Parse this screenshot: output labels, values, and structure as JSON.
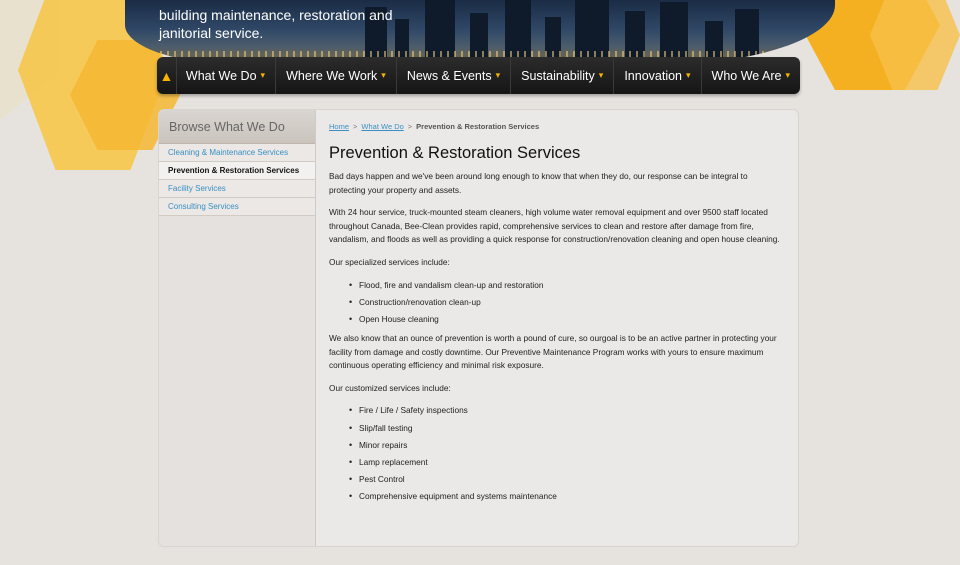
{
  "hero": {
    "tagline": "building maintenance, restoration and janitorial service."
  },
  "nav": {
    "home_icon": "home-icon",
    "items": [
      {
        "label": "What We Do"
      },
      {
        "label": "Where We Work"
      },
      {
        "label": "News & Events"
      },
      {
        "label": "Sustainability"
      },
      {
        "label": "Innovation"
      },
      {
        "label": "Who We Are"
      }
    ]
  },
  "sidebar": {
    "title": "Browse What We Do",
    "items": [
      {
        "label": "Cleaning & Maintenance Services",
        "active": false
      },
      {
        "label": "Prevention & Restoration Services",
        "active": true
      },
      {
        "label": "Facility Services",
        "active": false
      },
      {
        "label": "Consulting Services",
        "active": false
      }
    ]
  },
  "breadcrumb": {
    "home": "Home",
    "parent": "What We Do",
    "separator": ">",
    "current": "Prevention & Restoration Services"
  },
  "main": {
    "title": "Prevention & Restoration Services",
    "intro": "Bad days happen and we've been around long enough to know that when they do, our response can be integral to protecting your property and assets.",
    "para2": "With 24 hour service, truck-mounted steam cleaners, high volume water removal equipment and over 9500 staff located throughout Canada, Bee-Clean provides rapid, comprehensive services to clean and restore after damage from fire, vandalism, and floods as well as providing a quick response for construction/renovation cleaning and open house cleaning.",
    "specialized_heading": "Our specialized services include:",
    "specialized": [
      "Flood, fire and vandalism clean-up and restoration",
      "Construction/renovation clean-up",
      "Open House cleaning"
    ],
    "para3": "We also know that an ounce of prevention is worth a pound of cure, so ourgoal is to be an active partner in protecting your facility from damage and costly downtime. Our Preventive Maintenance Program works with yours to ensure maximum continuous operating efficiency and minimal risk exposure.",
    "customized_heading": "Our customized services include:",
    "customized": [
      "Fire / Life / Safety inspections",
      "Slip/fall testing",
      "Minor repairs",
      "Lamp replacement",
      "Pest Control",
      "Comprehensive equipment and systems maintenance"
    ]
  },
  "colors": {
    "accent": "#f5b400",
    "link": "#3a8fc4",
    "nav_bg": "#1c1c1c"
  }
}
